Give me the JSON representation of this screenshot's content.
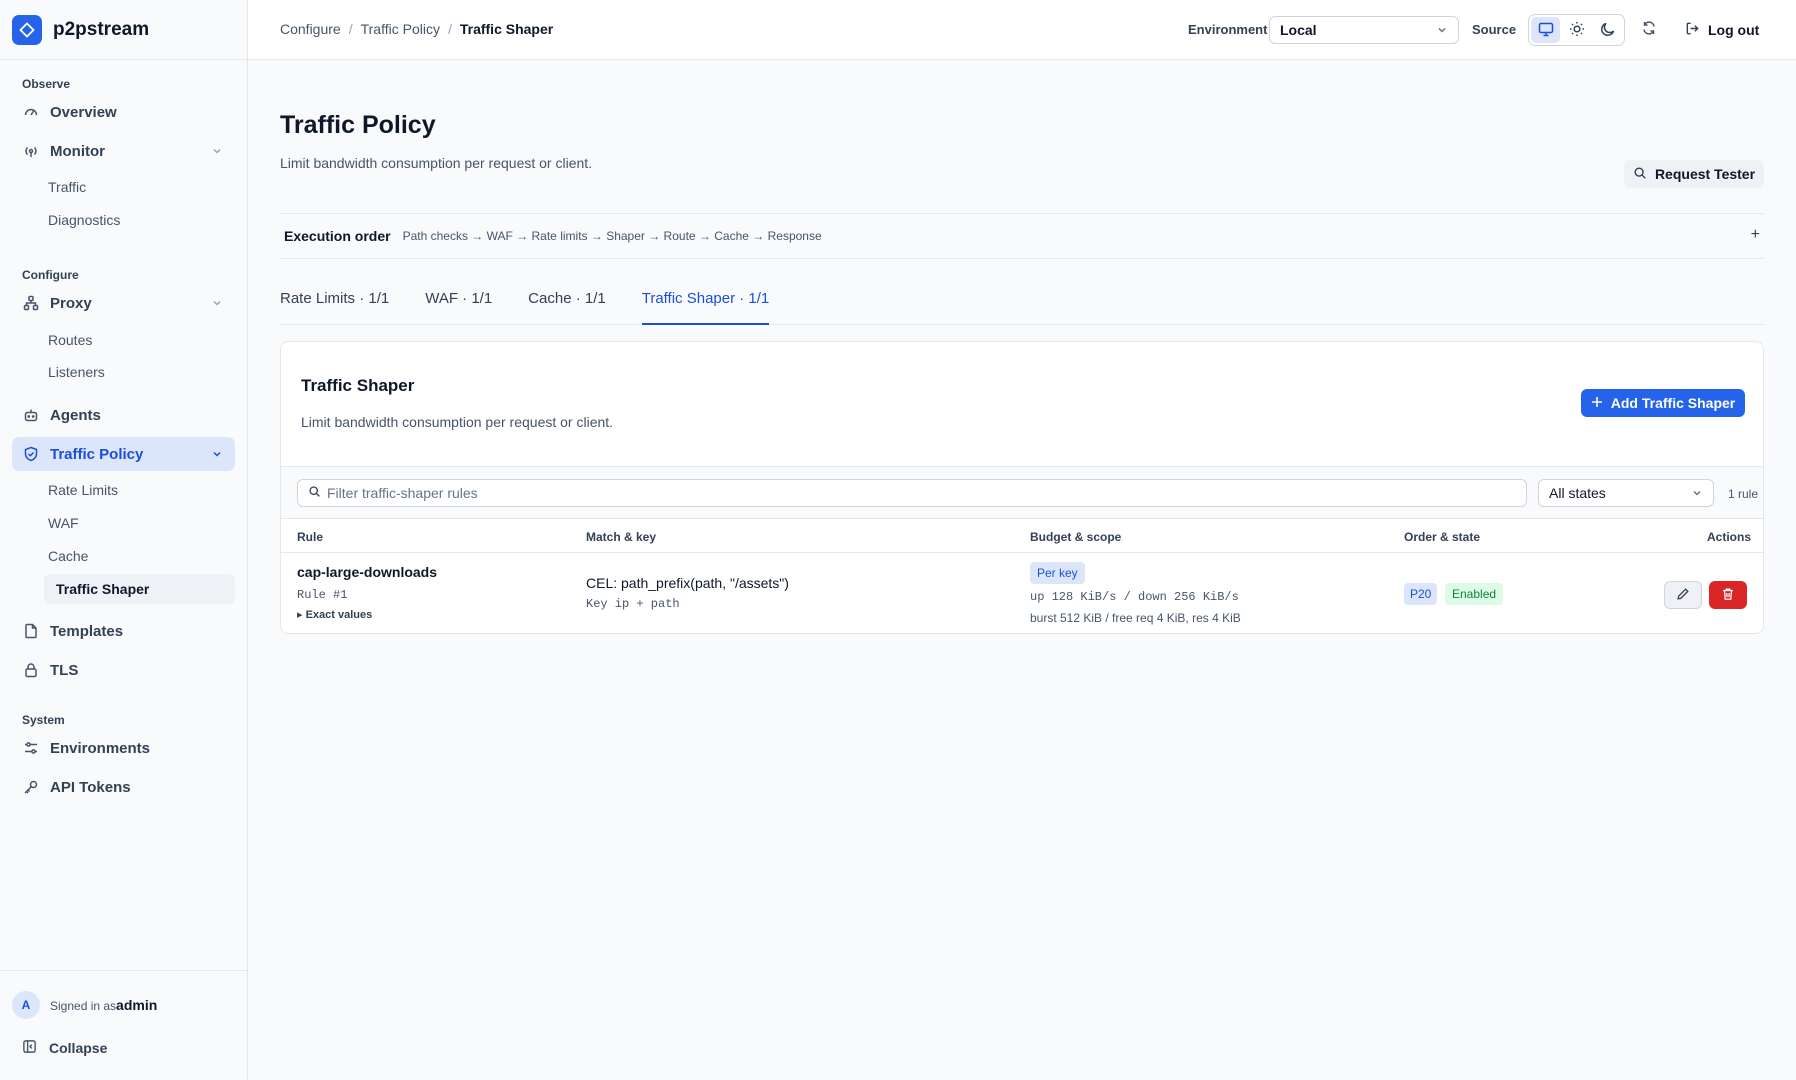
{
  "brand": {
    "name": "p2pstream"
  },
  "sidebar": {
    "sections": {
      "observe": "Observe",
      "configure": "Configure",
      "system": "System"
    },
    "items": {
      "overview": "Overview",
      "monitor": "Monitor",
      "traffic": "Traffic",
      "diagnostics": "Diagnostics",
      "proxy": "Proxy",
      "routes": "Routes",
      "listeners": "Listeners",
      "agents": "Agents",
      "traffic_policy": "Traffic Policy",
      "rate_limits": "Rate Limits",
      "waf": "WAF",
      "cache": "Cache",
      "traffic_shaper": "Traffic Shaper",
      "templates": "Templates",
      "tls": "TLS",
      "environments": "Environments",
      "api_tokens": "API Tokens"
    },
    "footer": {
      "avatar": "A",
      "signed_in_prefix": "Signed in as",
      "user": "admin",
      "collapse": "Collapse"
    }
  },
  "header": {
    "breadcrumb": [
      "Configure",
      "Traffic Policy",
      "Traffic Shaper"
    ],
    "separator": "/",
    "environment_label": "Environment",
    "environment_value": "Local",
    "source_label": "Source",
    "logout": "Log out"
  },
  "page": {
    "title": "Traffic Policy",
    "subtitle": "Limit bandwidth consumption per request or client.",
    "request_tester": "Request Tester",
    "execution": {
      "title": "Execution order",
      "steps": "Path checks → WAF → Rate limits → Shaper → Route → Cache → Response",
      "expand": "+"
    },
    "tabs": [
      "Rate Limits · 1/1",
      "WAF · 1/1",
      "Cache · 1/1",
      "Traffic Shaper · 1/1"
    ]
  },
  "card": {
    "title": "Traffic Shaper",
    "subtitle": "Limit bandwidth consumption per request or client.",
    "add_button": "Add Traffic Shaper",
    "filter_placeholder": "Filter traffic-shaper rules",
    "state_filter": "All states",
    "rule_count": "1 rule",
    "columns": [
      "Rule",
      "Match & key",
      "Budget & scope",
      "Order & state",
      "Actions"
    ],
    "rows": [
      {
        "name": "cap-large-downloads",
        "rule_id": "Rule #1",
        "exact_values": "▸ Exact values",
        "match": "CEL: path_prefix(path, \"/assets\")",
        "key": "Key ip + path",
        "scope": "Per key",
        "bandwidth": "up 128 KiB/s / down 256 KiB/s",
        "burst": "burst 512 KiB / free req 4 KiB, res 4 KiB",
        "priority": "P20",
        "state": "Enabled"
      }
    ]
  },
  "colors": {
    "accent": "#2563eb",
    "danger": "#dc2626",
    "success_bg": "#dcfce7",
    "success_text": "#15803d"
  }
}
